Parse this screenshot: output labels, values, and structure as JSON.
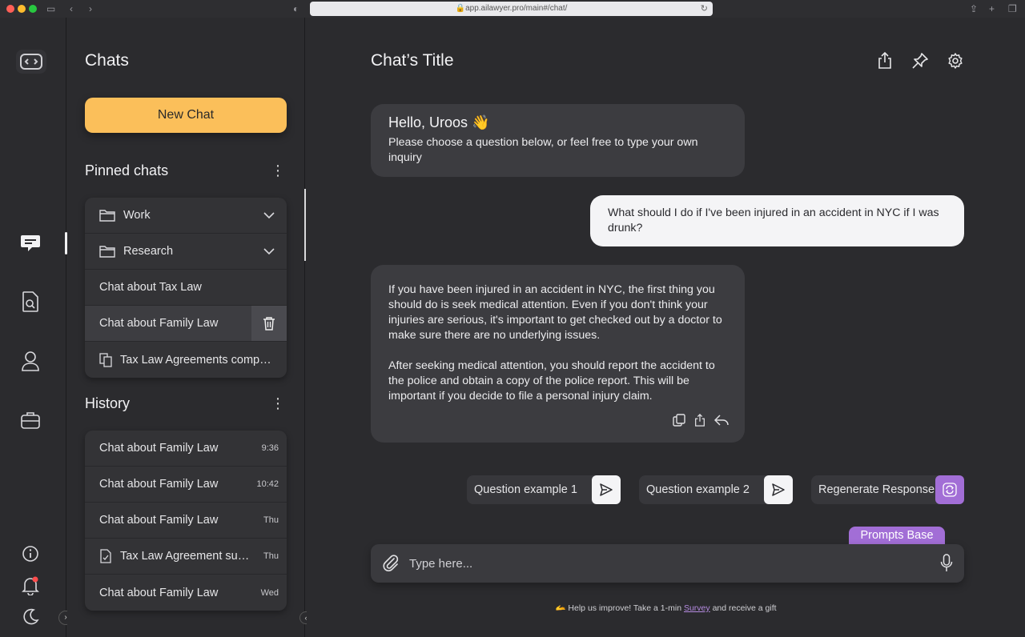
{
  "browser": {
    "url": "app.ailawyer.pro/main#/chat/"
  },
  "sidebar": {
    "title": "Chats",
    "new_chat_label": "New Chat",
    "pinned_title": "Pinned chats",
    "pinned": [
      {
        "label": "Work",
        "type": "folder"
      },
      {
        "label": "Research",
        "type": "folder"
      },
      {
        "label": "Chat about Tax Law",
        "type": "chat"
      },
      {
        "label": "Chat about Family Law",
        "type": "chat"
      },
      {
        "label": "Tax Law Agreements compar...",
        "type": "doc"
      }
    ],
    "history_title": "History",
    "history": [
      {
        "label": "Chat about Family Law",
        "time": "9:36"
      },
      {
        "label": "Chat about Family Law",
        "time": "10:42"
      },
      {
        "label": "Chat about Family Law",
        "time": "Thu"
      },
      {
        "label": "Tax Law Agreement sum...",
        "time": "Thu"
      },
      {
        "label": "Chat about Family Law",
        "time": "Wed"
      }
    ]
  },
  "main": {
    "title": "Chat’s Title",
    "greeting": "Hello, Uroos 👋",
    "greeting_sub": "Please choose a question below, or feel free to type your own inquiry",
    "user_message": "What should I do if I've been injured in an accident in NYC if I was drunk?",
    "ai_p1": "If you have been injured in an accident in NYC, the first thing you should do is seek medical attention. Even if you don't think your injuries are serious, it's important to get checked out by a doctor to make sure there are no underlying issues.",
    "ai_p2": "After seeking medical attention, you should report the accident to the police and obtain a copy of the police report. This will be important if you decide to file a personal injury claim.",
    "chips": [
      "Question example 1",
      "Question example 2"
    ],
    "regenerate_label": "Regenerate Response",
    "prompts_base_label": "Prompts Base",
    "input_placeholder": "Type here...",
    "footer_pre": "🫴 Help us improve! Take a 1-min",
    "footer_link": "Survey",
    "footer_post": "and receive a gift"
  },
  "colors": {
    "accent_yellow": "#fbbf5a",
    "accent_purple": "#a26ed6",
    "bg": "#2b2b2e"
  }
}
